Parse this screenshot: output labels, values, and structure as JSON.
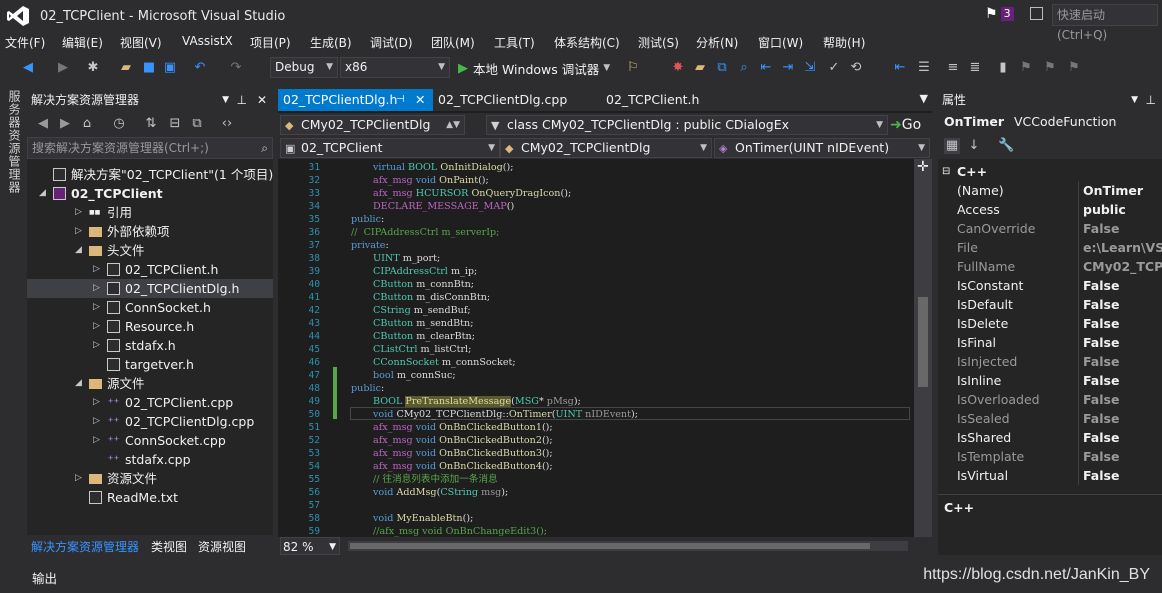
{
  "window": {
    "title": "02_TCPClient - Microsoft Visual Studio",
    "notification_count": "3",
    "quick_launch_placeholder": "快速启动 (Ctrl+Q)"
  },
  "menu": [
    "文件(F)",
    "编辑(E)",
    "视图(V)",
    "VAssistX",
    "项目(P)",
    "生成(B)",
    "调试(D)",
    "团队(M)",
    "工具(T)",
    "体系结构(C)",
    "测试(S)",
    "分析(N)",
    "窗口(W)",
    "帮助(H)"
  ],
  "toolbar": {
    "config": "Debug",
    "platform": "x86",
    "run_label": "本地 Windows 调试器"
  },
  "sidebar_strip": {
    "label": "服务器资源管理器"
  },
  "solution_explorer": {
    "title": "解决方案资源管理器",
    "search_placeholder": "搜索解决方案资源管理器(Ctrl+;)",
    "items": [
      {
        "label": "解决方案\"02_TCPClient\"(1 个项目)",
        "level": 0,
        "kind": "solution",
        "twisty": ""
      },
      {
        "label": "02_TCPClient",
        "level": 0,
        "kind": "project",
        "twisty": "◢"
      },
      {
        "label": "引用",
        "level": 1,
        "kind": "ref",
        "twisty": "▷"
      },
      {
        "label": "外部依赖项",
        "level": 1,
        "kind": "ext",
        "twisty": "▷"
      },
      {
        "label": "头文件",
        "level": 1,
        "kind": "folder",
        "twisty": "◢"
      },
      {
        "label": "02_TCPClient.h",
        "level": 2,
        "kind": "file",
        "twisty": "▷"
      },
      {
        "label": "02_TCPClientDlg.h",
        "level": 2,
        "kind": "file",
        "twisty": "▷",
        "selected": true
      },
      {
        "label": "ConnSocket.h",
        "level": 2,
        "kind": "file",
        "twisty": "▷"
      },
      {
        "label": "Resource.h",
        "level": 2,
        "kind": "file",
        "twisty": "▷"
      },
      {
        "label": "stdafx.h",
        "level": 2,
        "kind": "file",
        "twisty": "▷"
      },
      {
        "label": "targetver.h",
        "level": 2,
        "kind": "file",
        "twisty": ""
      },
      {
        "label": "源文件",
        "level": 1,
        "kind": "folder",
        "twisty": "◢"
      },
      {
        "label": "02_TCPClient.cpp",
        "level": 2,
        "kind": "cpp",
        "twisty": "▷"
      },
      {
        "label": "02_TCPClientDlg.cpp",
        "level": 2,
        "kind": "cpp",
        "twisty": "▷"
      },
      {
        "label": "ConnSocket.cpp",
        "level": 2,
        "kind": "cpp",
        "twisty": "▷"
      },
      {
        "label": "stdafx.cpp",
        "level": 2,
        "kind": "cpp",
        "twisty": ""
      },
      {
        "label": "资源文件",
        "level": 1,
        "kind": "folder",
        "twisty": "▷"
      },
      {
        "label": "ReadMe.txt",
        "level": 1,
        "kind": "file",
        "twisty": ""
      }
    ],
    "bottom_tabs": [
      "解决方案资源管理器",
      "类视图",
      "资源视图"
    ]
  },
  "editor": {
    "tabs": [
      "02_TCPClientDlg.h",
      "02_TCPClientDlg.cpp",
      "02_TCPClient.h"
    ],
    "nav1": {
      "left": "CMy02_TCPClientDlg",
      "right": "class CMy02_TCPClientDlg : public CDialogEx",
      "go": "Go"
    },
    "nav2": {
      "project": "02_TCPClient",
      "class": "CMy02_TCPClientDlg",
      "member": "OnTimer(UINT nIDEvent)"
    },
    "zoom": "82 %",
    "lines": [
      {
        "n": "31",
        "ind": 1,
        "t": [
          [
            "kw",
            "virtual "
          ],
          [
            "ty",
            "BOOL "
          ],
          [
            "fn",
            "OnInitDialog"
          ],
          [
            "",
            "();"
          ]
        ]
      },
      {
        "n": "32",
        "ind": 1,
        "t": [
          [
            "mc",
            "afx_msg "
          ],
          [
            "kw",
            "void "
          ],
          [
            "fn",
            "OnPaint"
          ],
          [
            "",
            "();"
          ]
        ]
      },
      {
        "n": "33",
        "ind": 1,
        "t": [
          [
            "mc",
            "afx_msg "
          ],
          [
            "ty",
            "HCURSOR "
          ],
          [
            "fn",
            "OnQueryDragIcon"
          ],
          [
            "",
            "();"
          ]
        ]
      },
      {
        "n": "34",
        "ind": 1,
        "t": [
          [
            "mc",
            "DECLARE_MESSAGE_MAP"
          ],
          [
            "",
            "()"
          ]
        ]
      },
      {
        "n": "35",
        "ind": 0,
        "t": [
          [
            "kw",
            "public"
          ],
          [
            "",
            ":"
          ]
        ]
      },
      {
        "n": "36",
        "ind": 0,
        "t": [
          [
            "cm",
            "//  CIPAddressCtrl m_serverIp;"
          ]
        ]
      },
      {
        "n": "37",
        "ind": 0,
        "t": [
          [
            "kw",
            "private"
          ],
          [
            "",
            ":"
          ]
        ]
      },
      {
        "n": "38",
        "ind": 1,
        "t": [
          [
            "ty",
            "UINT "
          ],
          [
            "",
            "m_port;"
          ]
        ]
      },
      {
        "n": "39",
        "ind": 1,
        "t": [
          [
            "ty",
            "CIPAddressCtrl "
          ],
          [
            "",
            "m_ip;"
          ]
        ]
      },
      {
        "n": "40",
        "ind": 1,
        "t": [
          [
            "ty",
            "CButton "
          ],
          [
            "",
            "m_connBtn;"
          ]
        ]
      },
      {
        "n": "41",
        "ind": 1,
        "t": [
          [
            "ty",
            "CButton "
          ],
          [
            "",
            "m_disConnBtn;"
          ]
        ]
      },
      {
        "n": "42",
        "ind": 1,
        "t": [
          [
            "ty",
            "CString "
          ],
          [
            "",
            "m_sendBuf;"
          ]
        ]
      },
      {
        "n": "43",
        "ind": 1,
        "t": [
          [
            "ty",
            "CButton "
          ],
          [
            "",
            "m_sendBtn;"
          ]
        ]
      },
      {
        "n": "44",
        "ind": 1,
        "t": [
          [
            "ty",
            "CButton "
          ],
          [
            "",
            "m_clearBtn;"
          ]
        ]
      },
      {
        "n": "45",
        "ind": 1,
        "t": [
          [
            "ty",
            "CListCtrl "
          ],
          [
            "",
            "m_listCtrl;"
          ]
        ]
      },
      {
        "n": "46",
        "ind": 1,
        "t": [
          [
            "ty",
            "CConnSocket "
          ],
          [
            "",
            "m_connSocket;"
          ]
        ]
      },
      {
        "n": "47",
        "ind": 1,
        "t": [
          [
            "kw",
            "bool "
          ],
          [
            "",
            "m_connSuc;"
          ]
        ]
      },
      {
        "n": "48",
        "ind": 0,
        "t": [
          [
            "kw",
            "public"
          ],
          [
            "",
            ":"
          ]
        ]
      },
      {
        "n": "49",
        "ind": 1,
        "t": [
          [
            "ty",
            "BOOL "
          ],
          [
            "fn",
            "PreTranslateMessage"
          ],
          [
            "",
            "("
          ],
          [
            "ty",
            "MSG"
          ],
          [
            "",
            "* "
          ],
          [
            "pm",
            "pMsg"
          ],
          [
            "",
            ");"
          ]
        ]
      },
      {
        "n": "50",
        "ind": 1,
        "t": [
          [
            "kw",
            "void "
          ],
          [
            "",
            "CMy02_TCPClientDlg::"
          ],
          [
            "fn",
            "OnTimer"
          ],
          [
            "",
            "("
          ],
          [
            "ty",
            "UINT "
          ],
          [
            "pm",
            "nIDEvent"
          ],
          [
            "",
            ");"
          ]
        ]
      },
      {
        "n": "51",
        "ind": 1,
        "t": [
          [
            "mc",
            "afx_msg "
          ],
          [
            "kw",
            "void "
          ],
          [
            "fn",
            "OnBnClickedButton1"
          ],
          [
            "",
            "();"
          ]
        ]
      },
      {
        "n": "52",
        "ind": 1,
        "t": [
          [
            "mc",
            "afx_msg "
          ],
          [
            "kw",
            "void "
          ],
          [
            "fn",
            "OnBnClickedButton2"
          ],
          [
            "",
            "();"
          ]
        ]
      },
      {
        "n": "53",
        "ind": 1,
        "t": [
          [
            "mc",
            "afx_msg "
          ],
          [
            "kw",
            "void "
          ],
          [
            "fn",
            "OnBnClickedButton3"
          ],
          [
            "",
            "();"
          ]
        ]
      },
      {
        "n": "54",
        "ind": 1,
        "t": [
          [
            "mc",
            "afx_msg "
          ],
          [
            "kw",
            "void "
          ],
          [
            "fn",
            "OnBnClickedButton4"
          ],
          [
            "",
            "();"
          ]
        ]
      },
      {
        "n": "55",
        "ind": 1,
        "t": [
          [
            "cm",
            "// 往消息列表中添加一条消息"
          ]
        ]
      },
      {
        "n": "56",
        "ind": 1,
        "t": [
          [
            "kw",
            "void "
          ],
          [
            "fn",
            "AddMsg"
          ],
          [
            "",
            "("
          ],
          [
            "ty",
            "CString "
          ],
          [
            "pm",
            "msg"
          ],
          [
            "",
            ");"
          ]
        ]
      },
      {
        "n": "57",
        "ind": 0,
        "t": []
      },
      {
        "n": "58",
        "ind": 1,
        "t": [
          [
            "kw",
            "void "
          ],
          [
            "fn",
            "MyEnableBtn"
          ],
          [
            "",
            "();"
          ]
        ]
      },
      {
        "n": "59",
        "ind": 1,
        "t": [
          [
            "cm",
            "//afx_msg void OnBnChangeEdit3();"
          ]
        ]
      }
    ]
  },
  "properties": {
    "title": "属性",
    "object_name": "OnTimer",
    "object_type": "VCCodeFunction",
    "category": "C++",
    "rows": [
      {
        "name": "(Name)",
        "value": "OnTimer",
        "gray": false
      },
      {
        "name": "Access",
        "value": "public",
        "gray": false
      },
      {
        "name": "CanOverride",
        "value": "False",
        "gray": true
      },
      {
        "name": "File",
        "value": "e:\\Learn\\VS\\",
        "gray": true
      },
      {
        "name": "FullName",
        "value": "CMy02_TCPC",
        "gray": true
      },
      {
        "name": "IsConstant",
        "value": "False",
        "gray": false
      },
      {
        "name": "IsDefault",
        "value": "False",
        "gray": false
      },
      {
        "name": "IsDelete",
        "value": "False",
        "gray": false
      },
      {
        "name": "IsFinal",
        "value": "False",
        "gray": false
      },
      {
        "name": "IsInjected",
        "value": "False",
        "gray": true
      },
      {
        "name": "IsInline",
        "value": "False",
        "gray": false
      },
      {
        "name": "IsOverloaded",
        "value": "False",
        "gray": true
      },
      {
        "name": "IsSealed",
        "value": "False",
        "gray": true
      },
      {
        "name": "IsShared",
        "value": "False",
        "gray": false
      },
      {
        "name": "IsTemplate",
        "value": "False",
        "gray": true
      },
      {
        "name": "IsVirtual",
        "value": "False",
        "gray": false
      }
    ],
    "description": "C++"
  },
  "output": {
    "label": "输出"
  },
  "watermark": "https://blog.csdn.net/JanKin_BY"
}
